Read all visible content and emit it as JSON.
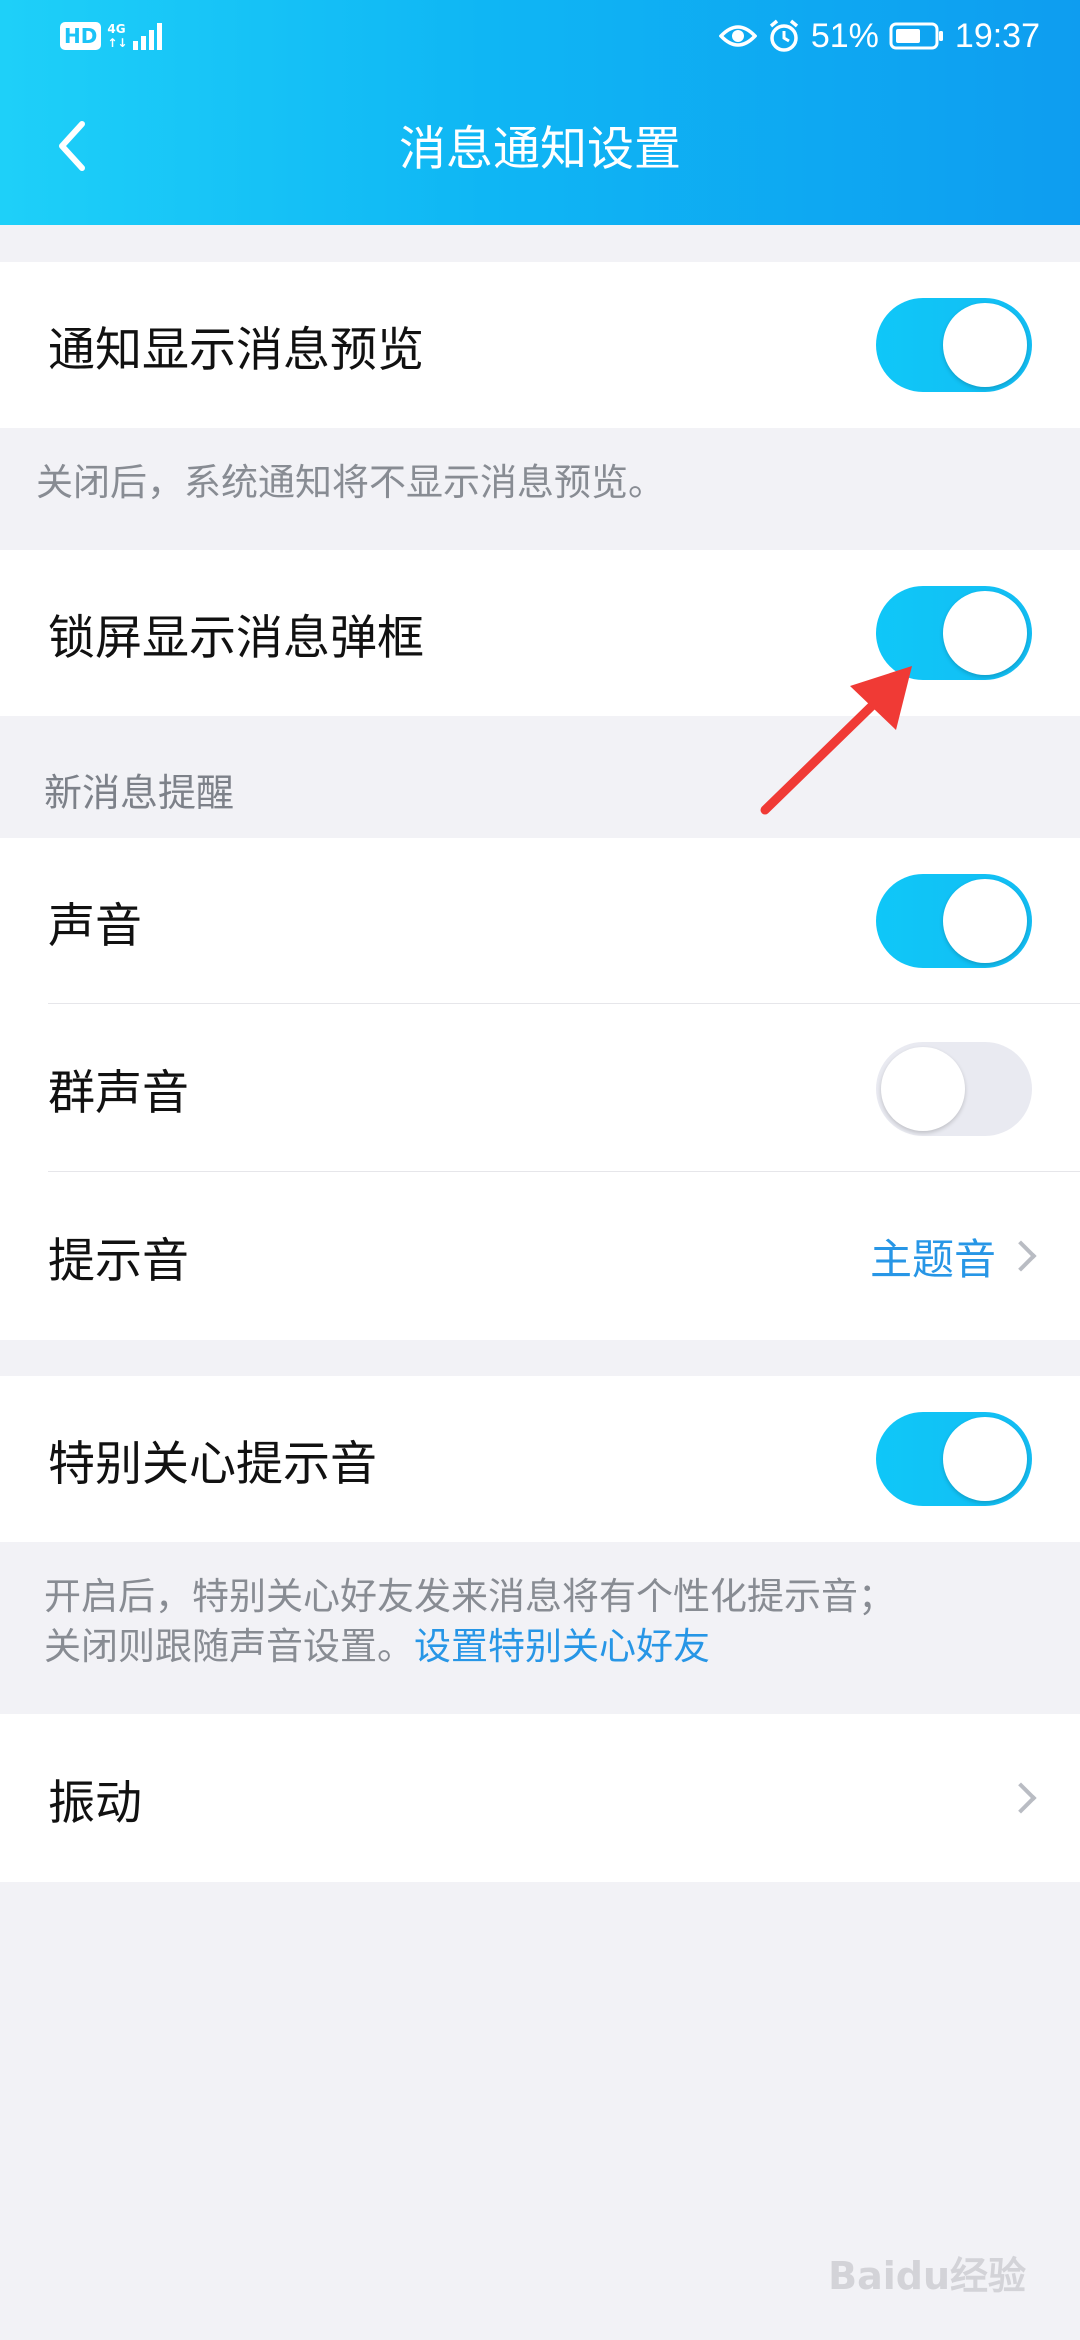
{
  "status_bar": {
    "hd": "HD",
    "network_gen": "4G",
    "network_sub": "↑↓",
    "battery": "51%",
    "time": "19:37",
    "icons": [
      "eye-icon",
      "alarm-icon",
      "battery-icon"
    ]
  },
  "header": {
    "title": "消息通知设置",
    "accent": "#12bdf5"
  },
  "settings": {
    "preview": {
      "label": "通知显示消息预览",
      "enabled": true
    },
    "preview_note": "关闭后，系统通知将不显示消息预览。",
    "lockscreen": {
      "label": "锁屏显示消息弹框",
      "enabled": true
    },
    "new_message_header": "新消息提醒",
    "sound": {
      "label": "声音",
      "enabled": true
    },
    "group_sound": {
      "label": "群声音",
      "enabled": false
    },
    "tone": {
      "label": "提示音",
      "value": "主题音"
    },
    "special_care": {
      "label": "特别关心提示音",
      "enabled": true
    },
    "special_note_line1": "开启后，特别关心好友发来消息将有个性化提示音；",
    "special_note_line2": "关闭则跟随声音设置。",
    "special_note_link": "设置特别关心好友",
    "vibration": {
      "label": "振动"
    }
  },
  "watermark": "Baidu经验"
}
